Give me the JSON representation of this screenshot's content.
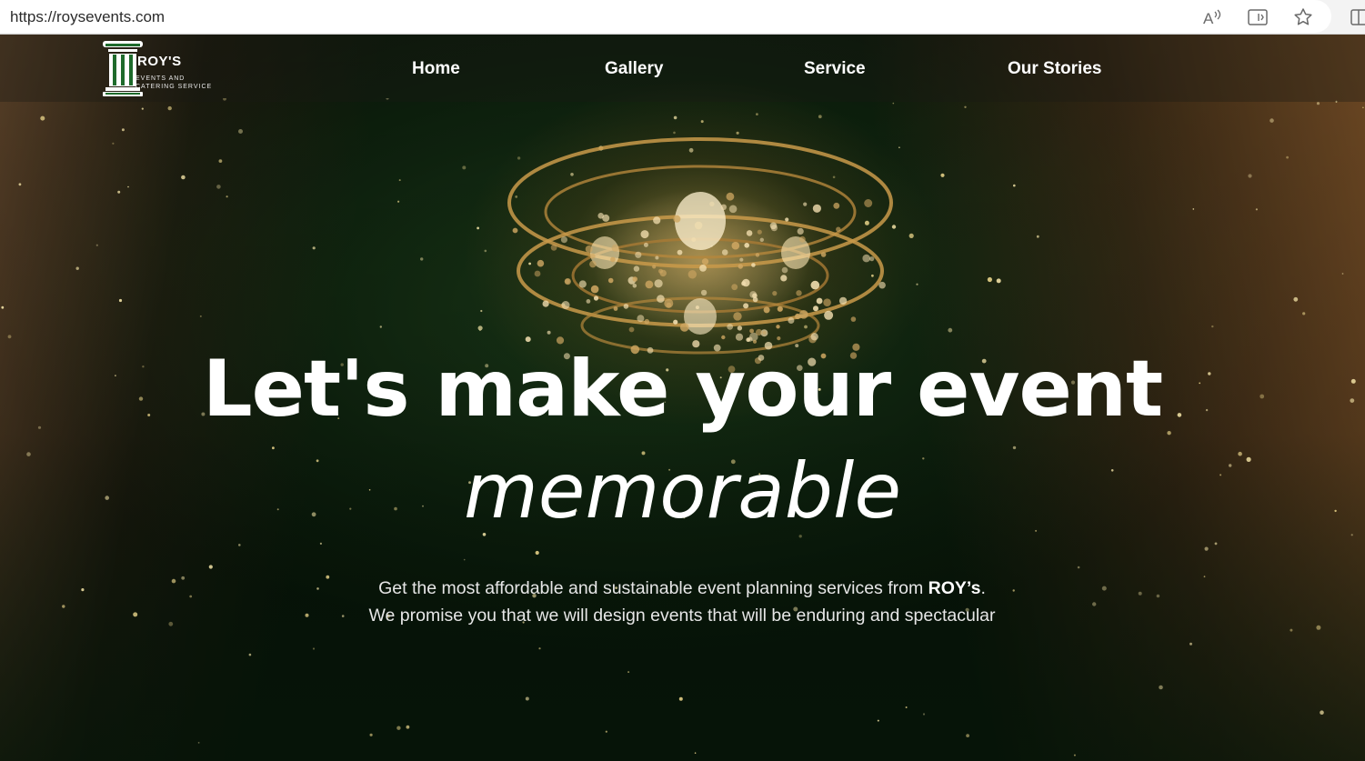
{
  "browser": {
    "url": "https://roysevents.com",
    "icons": [
      "read-aloud-icon",
      "immersive-reader-icon",
      "favorite-star-icon",
      "split-screen-icon"
    ]
  },
  "site": {
    "logo": {
      "name": "ROY'S",
      "tagline": "EVENTS AND CATERING SERVICE"
    },
    "nav": {
      "home": "Home",
      "gallery": "Gallery",
      "service": "Service",
      "stories": "Our Stories"
    }
  },
  "hero": {
    "headline_line1": "Let's make your event",
    "headline_line2": "memorable",
    "sub_intro": "Get the most affordable and sustainable event planning services from",
    "sub_brand": "ROY’s",
    "sub_rest": ". We promise you that we will design events that will be enduring and spectacular"
  },
  "colors": {
    "logo_green": "#1f6b2c",
    "text": "#ffffff",
    "background_dark_green": "#0f240f"
  }
}
